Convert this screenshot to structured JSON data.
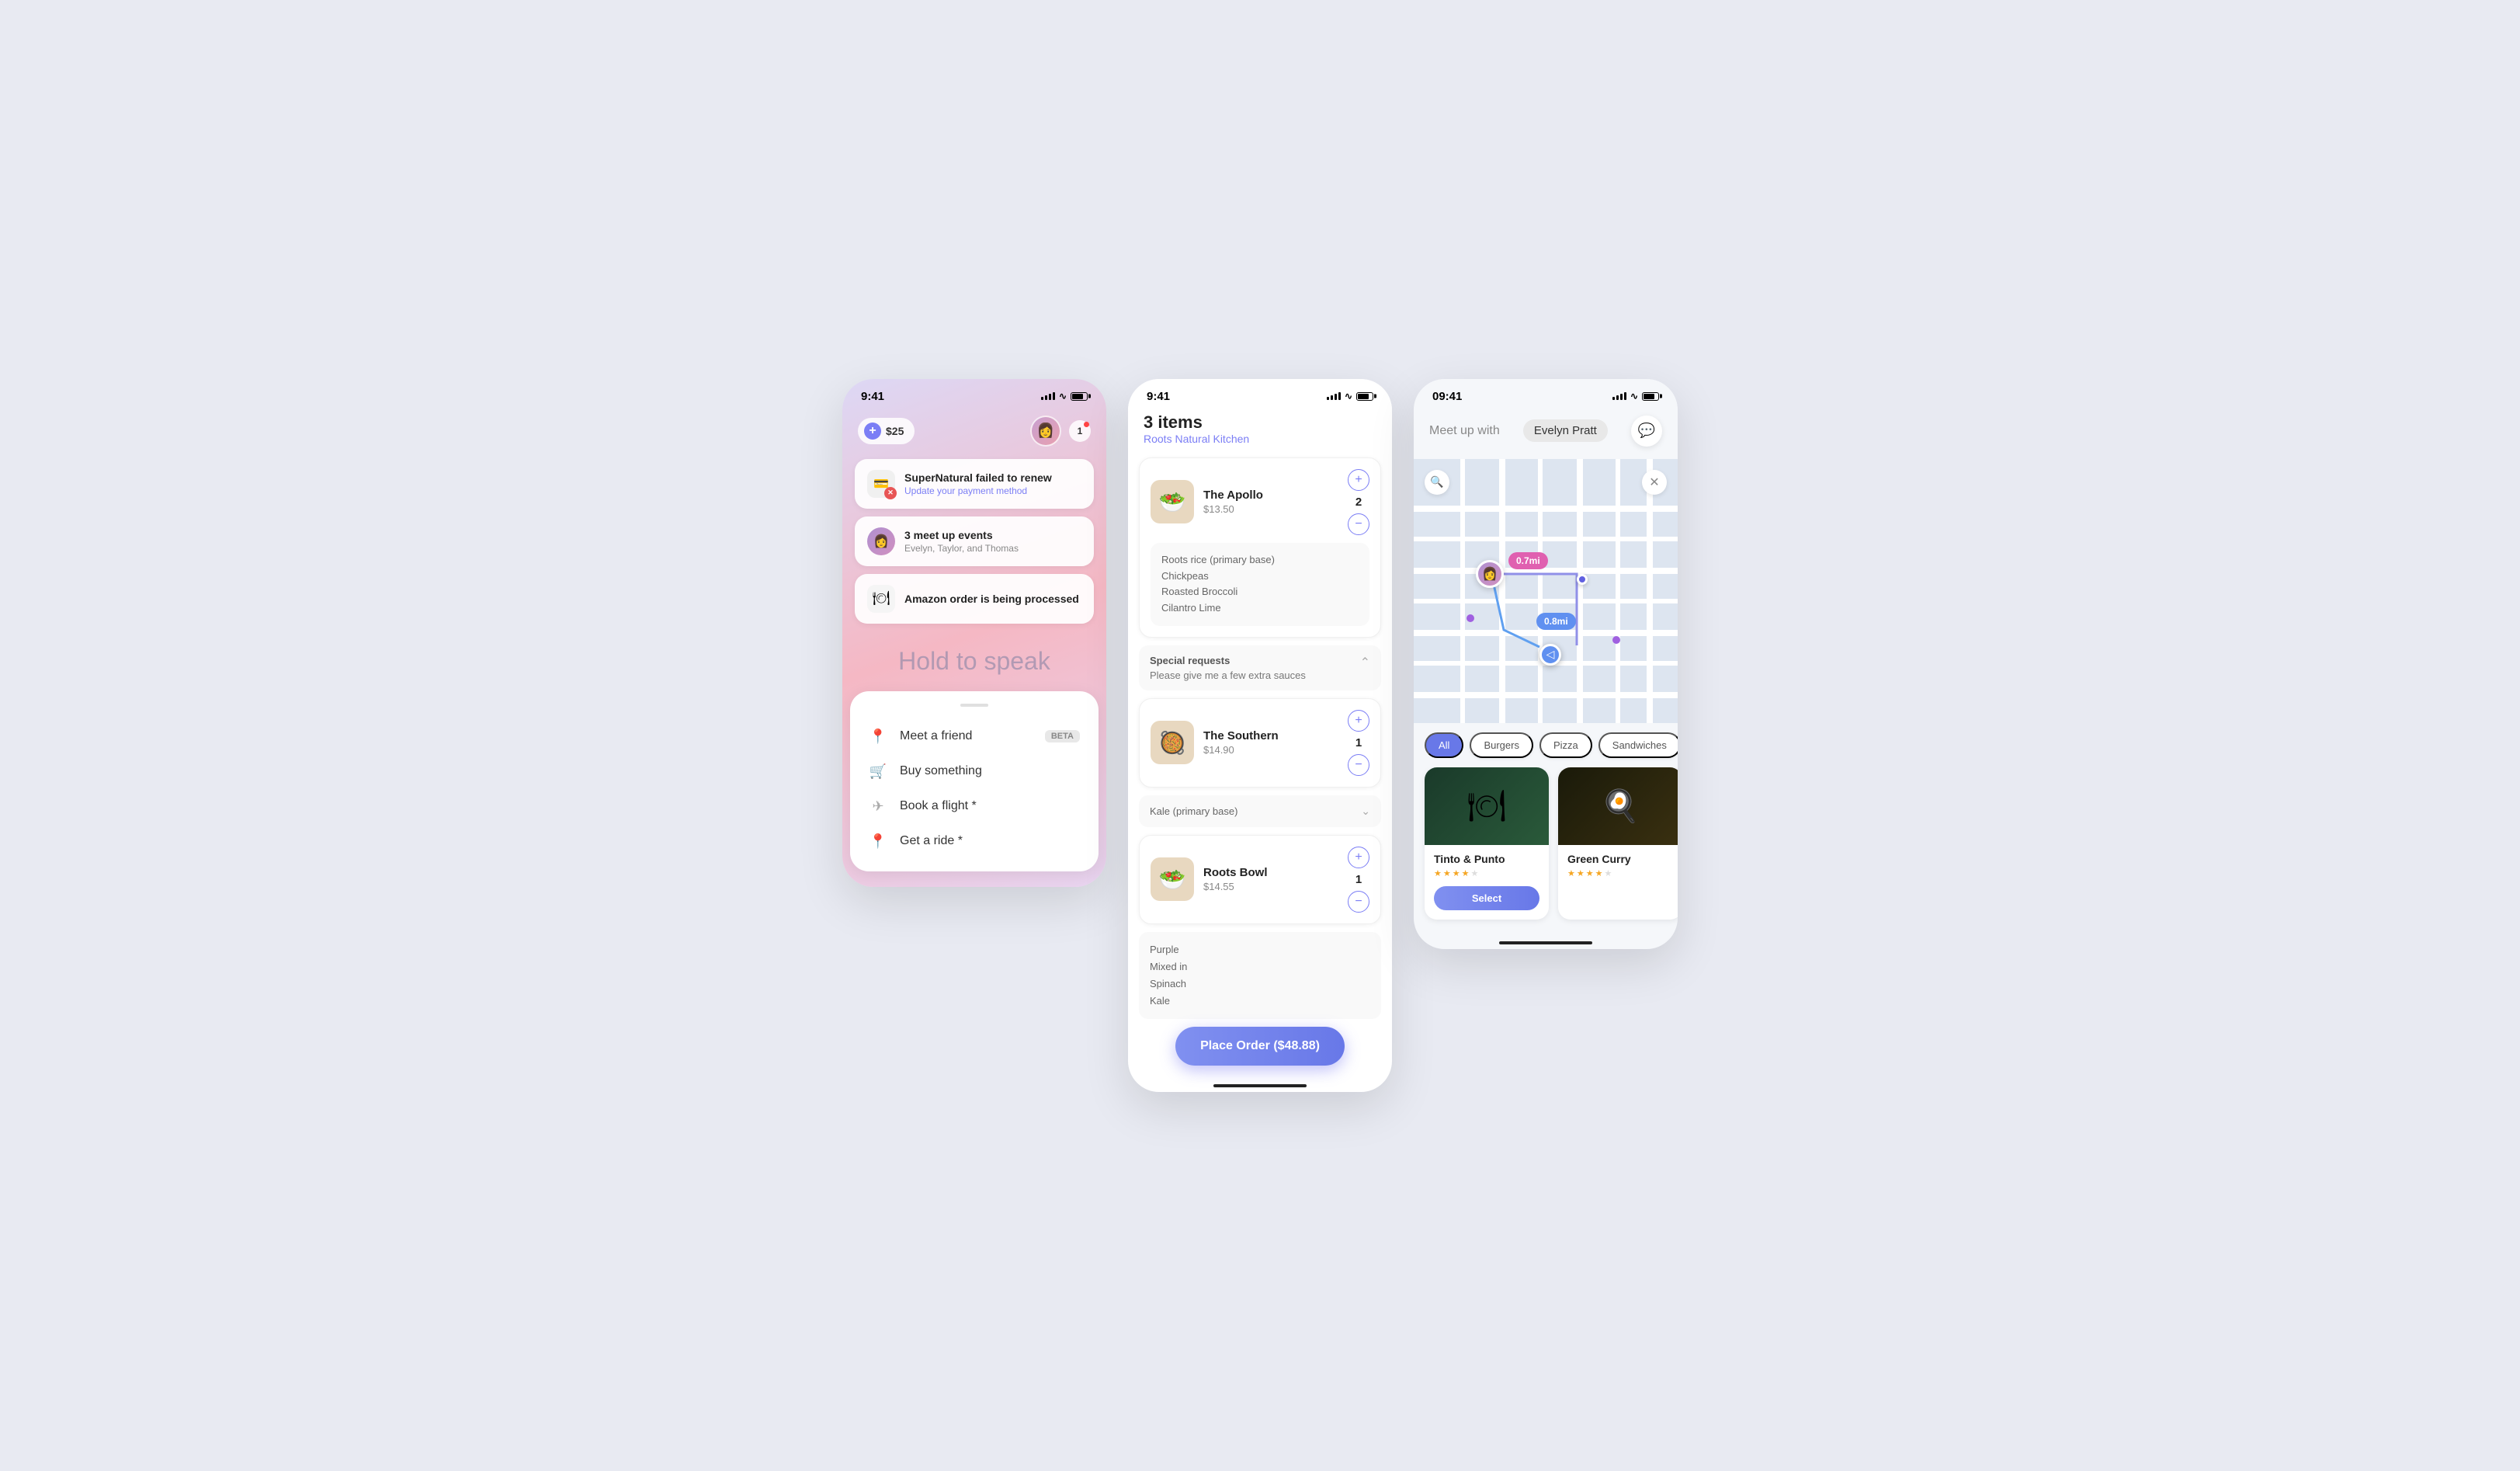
{
  "screen1": {
    "status": {
      "time": "9:41",
      "battery_level": 80
    },
    "credit": "$25",
    "notification_count": "1",
    "notifications": [
      {
        "id": "payment",
        "title": "SuperNatural failed to renew",
        "subtitle": "Update your payment method",
        "icon_type": "card"
      },
      {
        "id": "events",
        "title": "3 meet up events",
        "subtitle": "Evelyn, Taylor, and Thomas",
        "icon_type": "avatar"
      },
      {
        "id": "amazon",
        "title_prefix": "Amazon",
        "title_suffix": " order is being processed",
        "icon_type": "utensils"
      }
    ],
    "hold_text": "Hold to speak",
    "actions": [
      {
        "id": "friend",
        "label": "Meet a friend",
        "badge": "BETA",
        "icon": "📍"
      },
      {
        "id": "buy",
        "label": "Buy something",
        "icon": "🛒"
      },
      {
        "id": "flight",
        "label": "Book a flight *",
        "icon": "✈"
      },
      {
        "id": "ride",
        "label": "Get a ride *",
        "icon": "📍"
      }
    ]
  },
  "screen2": {
    "status": {
      "time": "9:41"
    },
    "order_count": "3 items",
    "restaurant": "Roots Natural Kitchen",
    "items": [
      {
        "name": "The Apollo",
        "price": "$13.50",
        "quantity": 2,
        "details": [
          "Roots rice (primary base)",
          "Chickpeas",
          "Roasted Broccoli",
          "Cilantro Lime"
        ],
        "emoji": "🥗"
      },
      {
        "name": "The Southern",
        "price": "$14.90",
        "quantity": 1,
        "details": [
          "Kale (primary base)"
        ],
        "has_dropdown": true,
        "emoji": "🥘"
      },
      {
        "name": "Roots Bowl",
        "price": "$14.55",
        "quantity": 1,
        "details": [
          "Purple",
          "Mixed in",
          "Spinach",
          "Kale"
        ],
        "emoji": "🥗"
      }
    ],
    "special_requests": {
      "label": "Special requests",
      "text": "Please give me a few extra sauces"
    },
    "place_order": "Place Order ($48.88)"
  },
  "screen3": {
    "status": {
      "time": "09:41"
    },
    "meetup_label": "Meet up with",
    "meetup_person": "Evelyn Pratt",
    "map": {
      "search_placeholder": "Search",
      "distance1": "0.7mi",
      "distance2": "0.8mi"
    },
    "filters": [
      {
        "label": "All",
        "active": true
      },
      {
        "label": "Burgers",
        "active": false
      },
      {
        "label": "Pizza",
        "active": false
      },
      {
        "label": "Sandwiches",
        "active": false
      }
    ],
    "restaurants": [
      {
        "name": "Tinto & Punto",
        "stars": 3.5,
        "max_stars": 5
      },
      {
        "name": "Green Curry",
        "stars": 3.5,
        "max_stars": 5
      }
    ],
    "select_label": "Select",
    "arrow_label": "→"
  }
}
